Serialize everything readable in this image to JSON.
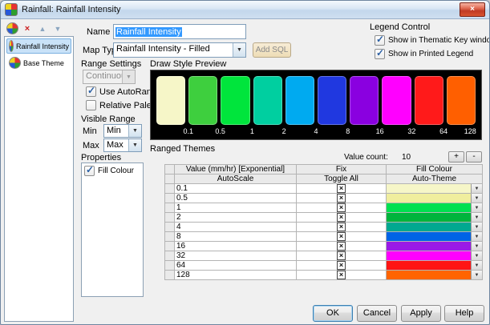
{
  "window": {
    "title": "Rainfall: Rainfall Intensity",
    "close_glyph": "×"
  },
  "sidebar": {
    "toolbar_icons": [
      "new-theme",
      "delete-theme",
      "move-up",
      "move-down"
    ],
    "items": [
      {
        "label": "Rainfall Intensity",
        "selected": true
      },
      {
        "label": "Base Theme",
        "selected": false
      }
    ]
  },
  "form": {
    "name_label": "Name",
    "name_value": "Rainfall Intensity",
    "map_type_label": "Map Type",
    "map_type_value": "Rainfall Intensity - Filled",
    "add_sql_label": "Add SQL",
    "legend_control": {
      "title": "Legend Control",
      "options": [
        {
          "label": "Show in Thematic Key window",
          "checked": true
        },
        {
          "label": "Show in Printed Legend",
          "checked": true
        }
      ]
    },
    "range_settings": {
      "title": "Range Settings",
      "mode_value": "Continuous",
      "use_autorange": {
        "label": "Use AutoRange",
        "checked": true
      },
      "relative_palette": {
        "label": "Relative Palette",
        "checked": false
      }
    },
    "visible_range": {
      "title": "Visible Range",
      "min_label": "Min",
      "min_value": "Min",
      "max_label": "Max",
      "max_value": "Max"
    },
    "properties": {
      "title": "Properties",
      "options": [
        {
          "label": "Fill Colour",
          "checked": true
        }
      ]
    }
  },
  "preview": {
    "title": "Draw Style Preview",
    "colors": [
      "#f6f6c8",
      "#3ecf3e",
      "#00e53c",
      "#00cfa0",
      "#00aaf0",
      "#2038e0",
      "#8a00e0",
      "#ff00ff",
      "#ff1a1a",
      "#ff5f00"
    ],
    "ticks": [
      "0.1",
      "0.5",
      "1",
      "2",
      "4",
      "8",
      "16",
      "32",
      "64",
      "128"
    ]
  },
  "ranged_themes": {
    "title": "Ranged Themes",
    "value_count_label": "Value count:",
    "value_count": "10",
    "add_button": "+",
    "remove_button": "-",
    "table": {
      "columns": [
        "",
        "Value (mm/hr) [Exponential]",
        "Fix",
        "Fill Colour"
      ],
      "subheader": [
        "",
        "AutoScale",
        "Toggle All",
        "Auto-Theme"
      ],
      "rows": [
        {
          "value": "0.1",
          "fix": true,
          "color": "#f6f6c8"
        },
        {
          "value": "0.5",
          "fix": true,
          "color": "#f0ee9e"
        },
        {
          "value": "1",
          "fix": true,
          "color": "#00e050"
        },
        {
          "value": "2",
          "fix": true,
          "color": "#00b43c"
        },
        {
          "value": "4",
          "fix": true,
          "color": "#00a890"
        },
        {
          "value": "8",
          "fix": true,
          "color": "#0064e6"
        },
        {
          "value": "16",
          "fix": true,
          "color": "#9a1ae6"
        },
        {
          "value": "32",
          "fix": true,
          "color": "#ff00ff"
        },
        {
          "value": "64",
          "fix": true,
          "color": "#ff1414"
        },
        {
          "value": "128",
          "fix": true,
          "color": "#ff6400"
        }
      ]
    }
  },
  "footer": {
    "ok": "OK",
    "cancel": "Cancel",
    "apply": "Apply",
    "help": "Help"
  }
}
